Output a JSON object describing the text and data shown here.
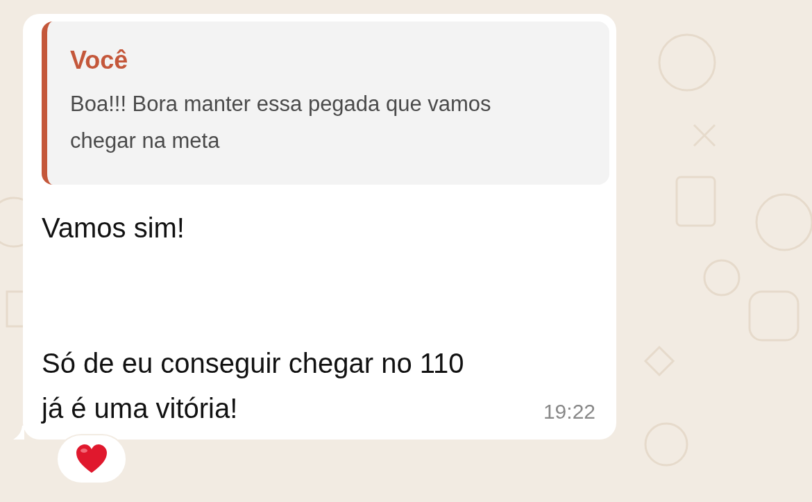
{
  "message": {
    "quote": {
      "author": "Você",
      "text": "Boa!!! Bora manter essa pegada que vamos chegar na meta",
      "color": "#c4573a"
    },
    "text": "Vamos sim!\n\n\nSó de eu conseguir chegar no 110\njá é uma vitória!",
    "time": "19:22",
    "reactions": [
      {
        "kind": "heart"
      }
    ]
  }
}
